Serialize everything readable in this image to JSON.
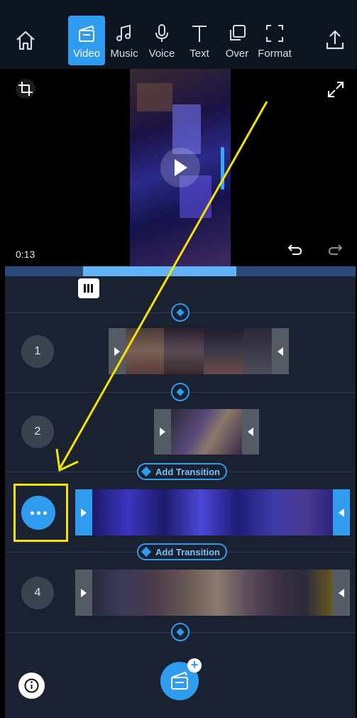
{
  "toolbar": {
    "tools": [
      {
        "label": "Video",
        "icon": "clapperboard-icon",
        "active": true
      },
      {
        "label": "Music",
        "icon": "music-note-icon"
      },
      {
        "label": "Voice",
        "icon": "microphone-icon"
      },
      {
        "label": "Text",
        "icon": "text-t-icon"
      },
      {
        "label": "Over",
        "icon": "overlay-icon"
      },
      {
        "label": "Format",
        "icon": "format-frame-icon"
      }
    ],
    "accent": "#2f9cf0"
  },
  "preview": {
    "timecode": "0:13"
  },
  "timeline": {
    "clips": [
      {
        "number": "1"
      },
      {
        "number": "2"
      },
      {
        "number": "",
        "selected": true
      },
      {
        "number": "4"
      }
    ],
    "add_transition_label": "Add Transition"
  },
  "annotation": {
    "highlight_color": "#f4e400"
  }
}
